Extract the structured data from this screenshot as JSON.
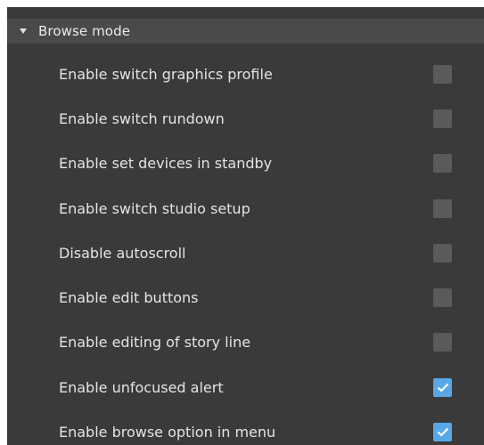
{
  "section": {
    "title": "Browse mode",
    "expanded": true,
    "icon": "triangle-down-icon"
  },
  "colors": {
    "panel_background": "#3a3a3a",
    "header_background": "#4a4a4a",
    "checkbox_unchecked": "#5a5a5a",
    "checkbox_checked": "#58a7e6",
    "text": "#e4e4e4"
  },
  "options": [
    {
      "label": "Enable switch graphics profile",
      "checked": false
    },
    {
      "label": "Enable switch rundown",
      "checked": false
    },
    {
      "label": "Enable set devices in standby",
      "checked": false
    },
    {
      "label": "Enable switch studio setup",
      "checked": false
    },
    {
      "label": "Disable autoscroll",
      "checked": false
    },
    {
      "label": "Enable edit buttons",
      "checked": false
    },
    {
      "label": "Enable editing of story line",
      "checked": false
    },
    {
      "label": "Enable unfocused alert",
      "checked": true
    },
    {
      "label": "Enable browse option in menu",
      "checked": true
    }
  ]
}
